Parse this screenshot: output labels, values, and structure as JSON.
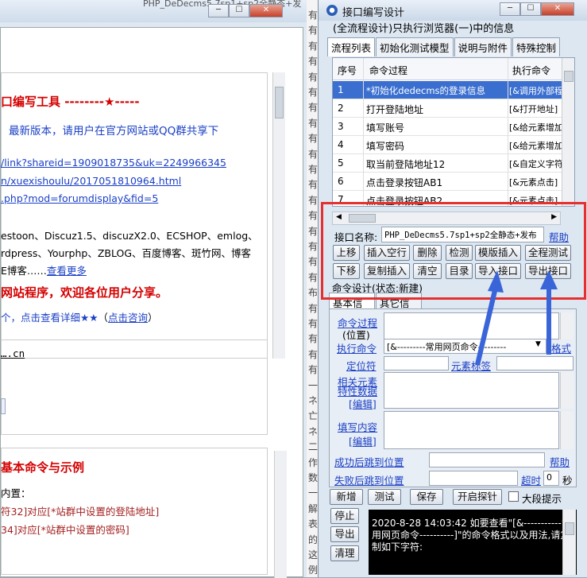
{
  "bg_window": {
    "title": "PHP_DeDecms5.7sp1+sp2全静态+发",
    "heading": "口编写工具  --------★-----",
    "notice": "最新版本，请用户在官方网站或QQ群共享下",
    "links": [
      "/link?shareid=1909018735&uk=2249966345",
      "n/xuexishoulu/2017051810964.html",
      ".php?mod=forumdisplay&fid=5"
    ],
    "cms_line1": "estoon、Discuz1.5、discuzX2.0、ECSHOP、emlog、",
    "cms_line2": "rdpress、Yourphp、ZBLOG、百度博客、斑竹网、博客",
    "cms_line3_a": "E博客……",
    "cms_line3_link": "查看更多",
    "promo": "网站程序，欢迎各位用户分享。",
    "promo2_a": "个，点击查看详细★★",
    "promo2_b": "（",
    "promo2_link": "点击咨询",
    "promo2_c": "）",
    "domain_text": "….cn",
    "section_title": "基本命令与示例",
    "section_line1": "内置：",
    "section_line2_a": "符32]对应",
    "section_line2_b": "[*站群中设置的登陆地址]",
    "section_line3_a": "34]对应",
    "section_line3_b": "[*站群中设置的密码]"
  },
  "side_column": [
    "有",
    "有",
    "有",
    "有",
    "有",
    "有",
    "有",
    "有",
    "有",
    "有",
    "有",
    "有",
    "有",
    "有",
    "有",
    "有",
    "有",
    "有",
    "布",
    "有",
    "有",
    "有",
    "有",
    "有",
    "一",
    "ネ",
    "亡",
    "ネ",
    "二",
    "作",
    "数",
    "一",
    "解",
    "表",
    "的",
    "这",
    "例"
  ],
  "main_window": {
    "title": "接口编写设计",
    "subtitle": "(全流程设计)只执行浏览器(一)中的信息",
    "tabs": [
      "流程列表",
      "初始化测试模型",
      "说明与附件",
      "特殊控制"
    ],
    "table_headers": [
      "序号",
      "命令过程",
      "执行命令"
    ],
    "rows": [
      {
        "num": "1",
        "proc": "*初始化dedecms的登录信息",
        "cmd": "[&调用外部程"
      },
      {
        "num": "2",
        "proc": "打开登陆地址",
        "cmd": "[&打开地址]"
      },
      {
        "num": "3",
        "proc": "填写账号",
        "cmd": "[&给元素增加"
      },
      {
        "num": "4",
        "proc": "填写密码",
        "cmd": "[&给元素增加"
      },
      {
        "num": "5",
        "proc": "取当前登陆地址12",
        "cmd": "[&自定义字符"
      },
      {
        "num": "6",
        "proc": "点击登录按钮AB1",
        "cmd": "[&元素点击]"
      },
      {
        "num": "7",
        "proc": "点击登录按钮AB2",
        "cmd": "[&元素点击]"
      }
    ],
    "iface_name_label": "接口名称:",
    "iface_name_value": "PHP_DeDecms5.7sp1+sp2全静态+发布",
    "help": "帮助",
    "btn_row1": [
      "上移",
      "插入空行",
      "删除",
      "检测",
      "模版插入",
      "全程测试"
    ],
    "btn_row2": [
      "下移",
      "复制插入",
      "清空",
      "目录",
      "导入接口",
      "导出接口"
    ],
    "design_status": "命令设计(状态:新建)",
    "subtabs": [
      "基本信息",
      "其它信息"
    ],
    "cmd_process": "命令过程",
    "position": "(位置)",
    "exec_cmd": "执行命令",
    "exec_select": "[&---------常用网页命令---------",
    "format": "格式",
    "locator": "定位符",
    "elem_tag": "元素标签",
    "related_elem": "相关元素",
    "feature_data": "特性数据",
    "edit": "[编辑]",
    "fill_content": "填写内容",
    "success_jump": "成功后跳到位置",
    "fail_jump": "失败后跳到位置",
    "timeout": "超时",
    "timeout_value": "0",
    "seconds": "秒",
    "bottom_btns": [
      "新增",
      "测试",
      "保存",
      "开启探针"
    ],
    "large_hint": "大段提示",
    "side_btns": [
      "停止",
      "导出",
      "清理"
    ],
    "console": "2020-8-28 14:03:42  如要查看\"[&-----------常用网页命令----------]\"的命令格式以及用法,请复制如下字符:"
  },
  "colors": {
    "highlight_box": "#e53030",
    "arrow": "#3a65d8",
    "selected_row": "#3a6fd0"
  }
}
